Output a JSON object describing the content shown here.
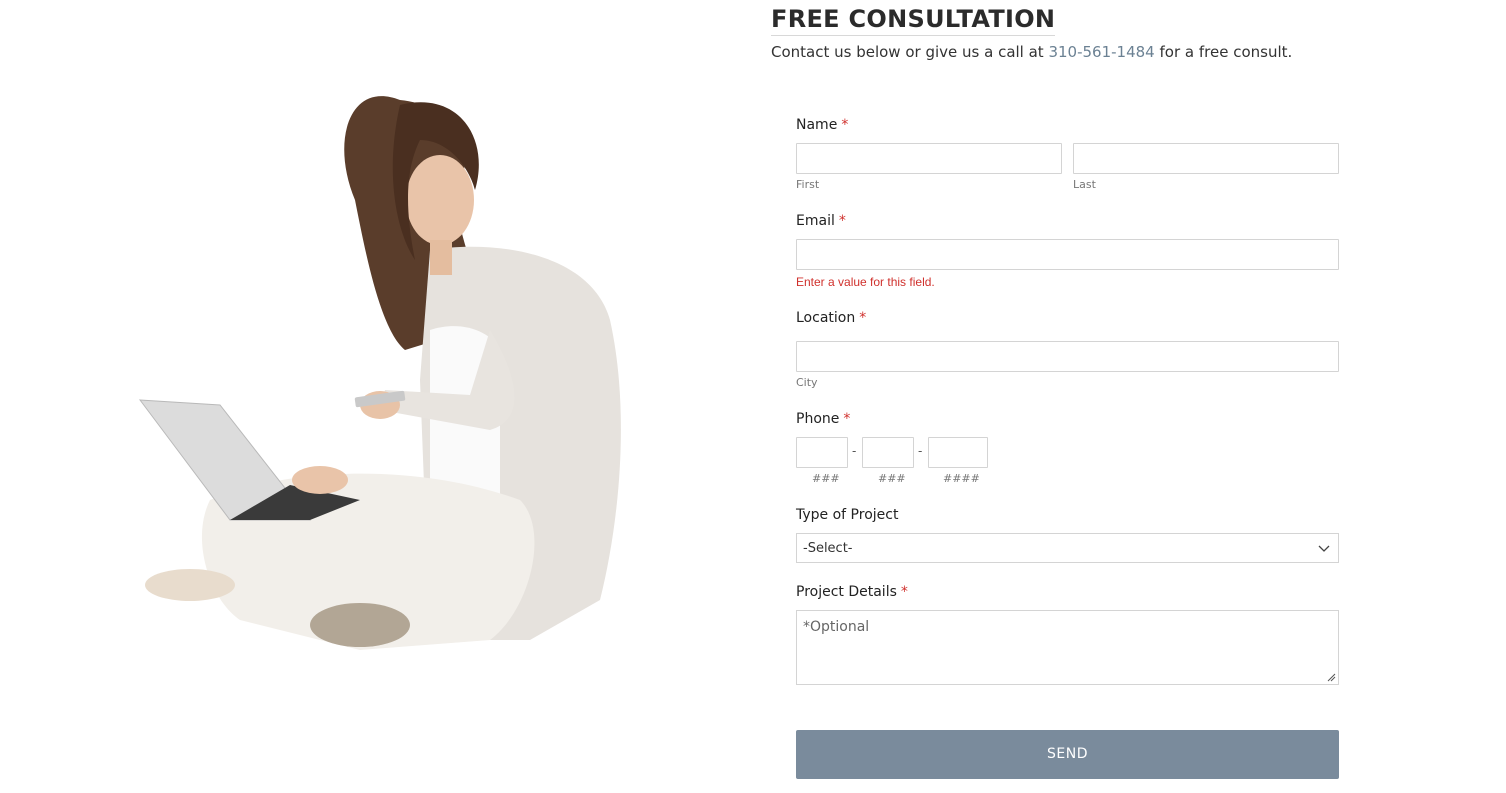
{
  "header": {
    "title": "FREE CONSULTATION",
    "subtitle_before": "Contact us below or give us a call at ",
    "phone": "310-561-1484",
    "subtitle_after": " for a free consult."
  },
  "form": {
    "name": {
      "label": "Name",
      "required_mark": "*",
      "first_sub": "First",
      "last_sub": "Last",
      "first_value": "",
      "last_value": ""
    },
    "email": {
      "label": "Email",
      "required_mark": "*",
      "value": "",
      "error": "Enter a value for this field."
    },
    "location": {
      "label": "Location",
      "required_mark": "*",
      "value": "",
      "city_sub": "City"
    },
    "phone": {
      "label": "Phone",
      "required_mark": "*",
      "dash": "-",
      "sub1": "###",
      "sub2": "###",
      "sub3": "####"
    },
    "project_type": {
      "label": "Type of Project",
      "selected": "-Select-"
    },
    "project_details": {
      "label": "Project Details",
      "required_mark": "*",
      "placeholder": "*Optional"
    },
    "send_label": "SEND"
  },
  "hero_image": {
    "icon": "woman-with-laptop-image"
  },
  "colors": {
    "accent": "#7a8b9c",
    "link": "#6b8193",
    "error": "#d0312d",
    "border": "#d4d4d4"
  }
}
